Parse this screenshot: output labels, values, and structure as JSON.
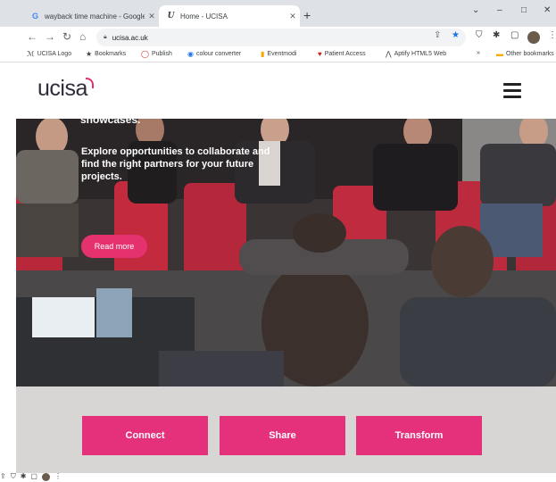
{
  "browser": {
    "tabs": [
      {
        "title": "wayback time machine - Google",
        "favicon": "G",
        "active": false
      },
      {
        "title": "Home - UCISA",
        "favicon": "U",
        "active": true
      }
    ],
    "new_tab": "+",
    "window_controls": {
      "tabsearch": "⌄",
      "minimize": "–",
      "maximize": "□",
      "close": "✕"
    },
    "address": "ucisa.ac.uk",
    "bookmarks": [
      {
        "label": "UCISA Logo",
        "icon": "ucisa-icon"
      },
      {
        "label": "Bookmarks",
        "icon": "star-icon"
      },
      {
        "label": "Publish",
        "icon": "publish-icon"
      },
      {
        "label": "colour converter",
        "icon": "chrome-icon"
      },
      {
        "label": "Eventmodi",
        "icon": "doc-icon"
      },
      {
        "label": "Patient Access",
        "icon": "heart-icon"
      },
      {
        "label": "Aptify HTML5 Web",
        "icon": "aptify-icon"
      }
    ],
    "bookmarks_overflow": "»",
    "other_bookmarks": "Other bookmarks"
  },
  "site": {
    "logo": "ucisa",
    "hero": {
      "line1": "showcases.",
      "line2": "Explore opportunities to collaborate and find the right partners for your future projects.",
      "button": "Read more"
    },
    "ctas": [
      "Connect",
      "Share",
      "Transform"
    ]
  },
  "colors": {
    "accent": "#e5317b",
    "readmore": "#e5316d",
    "band": "#d8d6d4"
  }
}
